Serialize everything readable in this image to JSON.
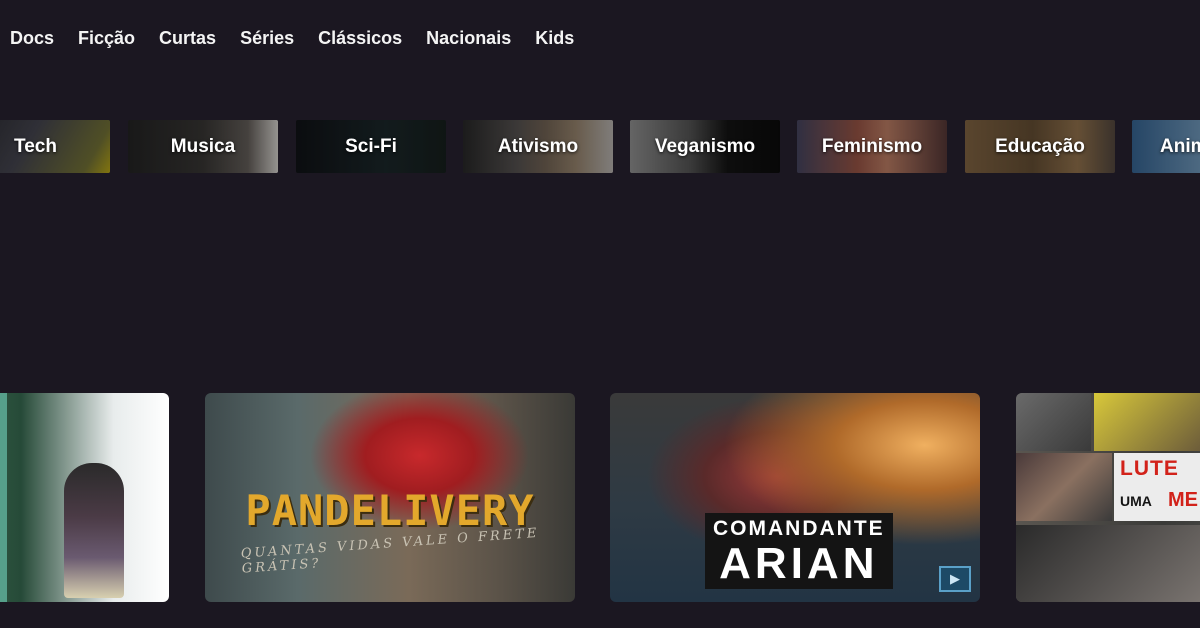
{
  "nav": {
    "items": [
      {
        "label": "Docs"
      },
      {
        "label": "Ficção"
      },
      {
        "label": "Curtas"
      },
      {
        "label": "Séries"
      },
      {
        "label": "Clássicos"
      },
      {
        "label": "Nacionais"
      },
      {
        "label": "Kids"
      }
    ]
  },
  "genres": [
    {
      "label": "Tech"
    },
    {
      "label": "Musica"
    },
    {
      "label": "Sci-Fi"
    },
    {
      "label": "Ativismo"
    },
    {
      "label": "Veganismo"
    },
    {
      "label": "Feminismo"
    },
    {
      "label": "Educação"
    },
    {
      "label": "Anim"
    }
  ],
  "cards": [
    {
      "title": ""
    },
    {
      "title": "PANDELIVERY",
      "subtitle": "QUANTAS VIDAS VALE O FRETE GRÁTIS?"
    },
    {
      "title_line1": "COMANDANTE",
      "title_line2": "ARIAN"
    },
    {
      "line1": "LUTE",
      "line2": "UMA",
      "line3": "ME"
    }
  ],
  "colors": {
    "background": "#1b1721",
    "pandelivery_title": "#e3a82c",
    "lute_red": "#d2221a"
  }
}
